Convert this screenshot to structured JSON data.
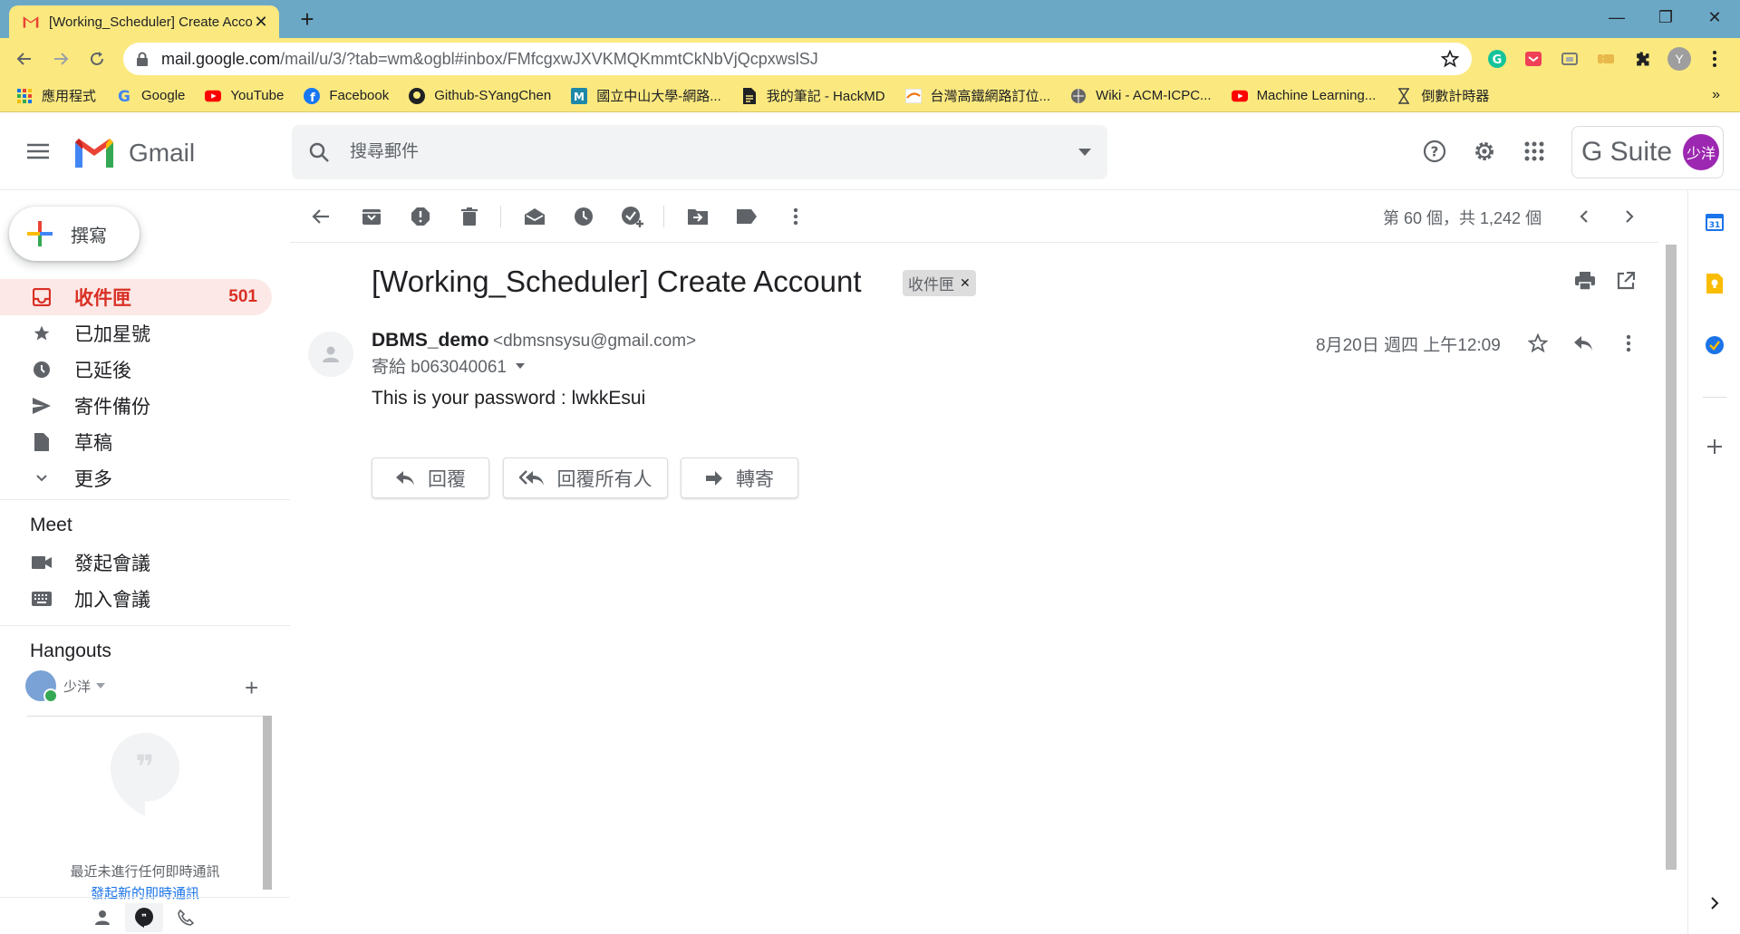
{
  "browser": {
    "tab_title": "[Working_Scheduler] Create Account",
    "url_host": "mail.google.com",
    "url_path": "/mail/u/3/?tab=wm&ogbl#inbox/FMfcgxwJXVKMQKmmtCkNbVjQcpxwslSJ",
    "profile_initial": "Y",
    "bookmarks": [
      {
        "label": "應用程式",
        "icon": "apps-grid-icon"
      },
      {
        "label": "Google",
        "icon": "google-g-icon"
      },
      {
        "label": "YouTube",
        "icon": "youtube-icon"
      },
      {
        "label": "Facebook",
        "icon": "facebook-icon"
      },
      {
        "label": "Github-SYangChen",
        "icon": "github-icon"
      },
      {
        "label": "國立中山大學-網路...",
        "icon": "nsysu-icon"
      },
      {
        "label": "我的筆記 - HackMD",
        "icon": "document-icon"
      },
      {
        "label": "台灣高鐵網路訂位...",
        "icon": "thsr-icon"
      },
      {
        "label": "Wiki - ACM-ICPC...",
        "icon": "wiki-icon"
      },
      {
        "label": "Machine Learning...",
        "icon": "youtube-icon"
      },
      {
        "label": "倒數計時器",
        "icon": "hourglass-icon"
      }
    ],
    "bookmarks_more": "»"
  },
  "gmail": {
    "logo_text": "Gmail",
    "search_placeholder": "搜尋郵件",
    "gsuite_text": "G Suite",
    "avatar_text": "少洋",
    "compose_label": "撰寫",
    "nav": [
      {
        "label": "收件匣",
        "count": "501",
        "icon": "inbox-icon",
        "active": true
      },
      {
        "label": "已加星號",
        "count": "",
        "icon": "star-icon"
      },
      {
        "label": "已延後",
        "count": "",
        "icon": "clock-icon"
      },
      {
        "label": "寄件備份",
        "count": "",
        "icon": "send-icon"
      },
      {
        "label": "草稿",
        "count": "",
        "icon": "draft-icon"
      },
      {
        "label": "更多",
        "count": "",
        "icon": "chevron-down-icon"
      }
    ],
    "meet": {
      "title": "Meet",
      "items": [
        {
          "label": "發起會議",
          "icon": "videocam-icon"
        },
        {
          "label": "加入會議",
          "icon": "keyboard-icon"
        }
      ]
    },
    "hangouts": {
      "title": "Hangouts",
      "user": "少洋",
      "empty_text": "最近未進行任何即時通訊",
      "start_link": "發起新的即時通訊"
    },
    "pager": "第 60 個，共 1,242 個",
    "email": {
      "subject": "[Working_Scheduler] Create Account",
      "label": "收件匣",
      "sender_name": "DBMS_demo",
      "sender_email": "<dbmsnsysu@gmail.com>",
      "to": "寄給 b063040061",
      "date": "8月20日 週四 上午12:09",
      "body": "This is your password : lwkkEsui"
    },
    "actions": {
      "reply": "回覆",
      "reply_all": "回覆所有人",
      "forward": "轉寄"
    }
  },
  "colors": {
    "accent_red": "#d93025",
    "tabstrip": "#6ba8c6",
    "chrome_yellow": "#fbe97f"
  }
}
